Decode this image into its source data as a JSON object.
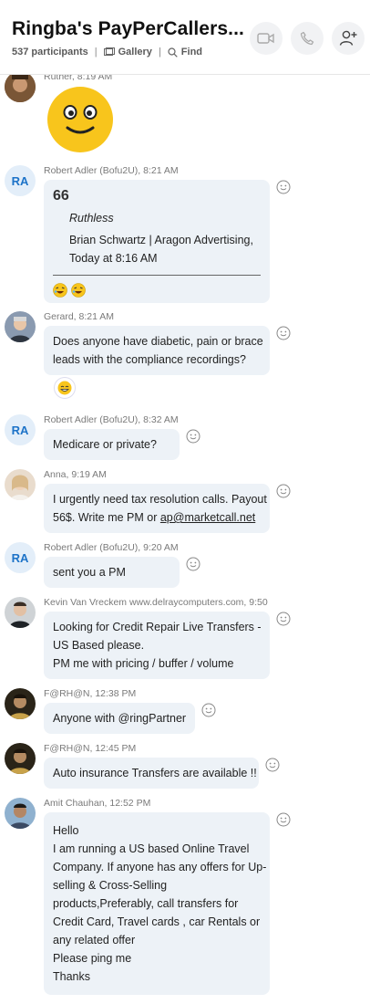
{
  "header": {
    "title": "Ringba's PayPerCallers...",
    "participants": "537 participants",
    "gallery": "Gallery",
    "find": "Find",
    "video_icon": "video-camera-icon",
    "call_icon": "phone-icon",
    "add_icon": "add-person-icon"
  },
  "messages": [
    {
      "sender": "Ruther, 8:19 AM",
      "content": "emoji-smile"
    },
    {
      "sender": "Robert Adler (Bofu2U), 8:21 AM",
      "avatar_initials": "RA",
      "quote_mark": "66",
      "quote_text": "Ruthless",
      "quote_author_line1": "Brian Schwartz | Aragon Advertising,",
      "quote_author_line2": "Today at 8:16 AM"
    },
    {
      "sender": "Gerard, 8:21 AM",
      "lines": [
        "Does anyone have diabetic, pain or brace",
        "leads with the compliance recordings?"
      ]
    },
    {
      "sender": "Robert Adler (Bofu2U), 8:32 AM",
      "avatar_initials": "RA",
      "lines": [
        "Medicare or private?"
      ]
    },
    {
      "sender": "Anna, 9:19 AM",
      "lines": [
        "I urgently need tax resolution calls. Payout",
        "56$. Write me PM or "
      ],
      "link": "ap@marketcall.net"
    },
    {
      "sender": "Robert Adler (Bofu2U), 9:20 AM",
      "avatar_initials": "RA",
      "lines": [
        "sent you a PM"
      ]
    },
    {
      "sender": "Kevin Van Vreckem www.delraycomputers.com, 9:50",
      "lines": [
        "Looking for Credit Repair Live Transfers -",
        "US Based please.",
        "PM me with pricing / buffer / volume"
      ]
    },
    {
      "sender": "F@RH@N, 12:38 PM",
      "lines": [
        "Anyone with @ringPartner"
      ]
    },
    {
      "sender": "F@RH@N, 12:45 PM",
      "lines": [
        "Auto insurance Transfers are available !!"
      ]
    },
    {
      "sender": "Amit Chauhan, 12:52 PM",
      "lines": [
        "Hello",
        "I am running a US based Online Travel",
        "Company. If anyone has any offers for Up-",
        "selling & Cross-Selling",
        "products,Preferably, call transfers for",
        "Credit Card, Travel cards , car Rentals or",
        "any related offer",
        "Please ping me",
        "Thanks"
      ]
    }
  ]
}
